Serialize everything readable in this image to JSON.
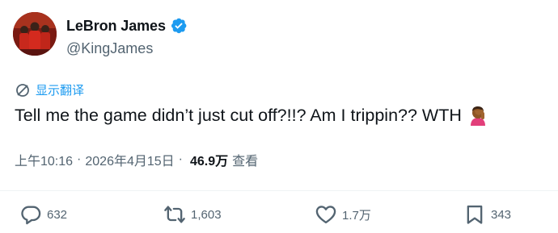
{
  "author": {
    "name": "LeBron James",
    "handle": "@KingJames",
    "verified": true,
    "verified_color": "#1d9bf0"
  },
  "translate_label": "显示翻译",
  "tweet": {
    "text": "Tell me the game didn’t just cut off?!!? Am I trippin?? WTH",
    "emoji": "facepalm-emoji"
  },
  "meta": {
    "time": "上午10:16",
    "separator": "·",
    "date": "2026年4月15日",
    "separator2": "·",
    "views": "46.9万",
    "views_label": "查看"
  },
  "actions": {
    "replies": "632",
    "reposts": "1,603",
    "likes": "1.7万",
    "bookmarks": "343"
  },
  "colors": {
    "accent": "#1d9bf0",
    "text": "#0f1419",
    "muted": "#536471"
  }
}
